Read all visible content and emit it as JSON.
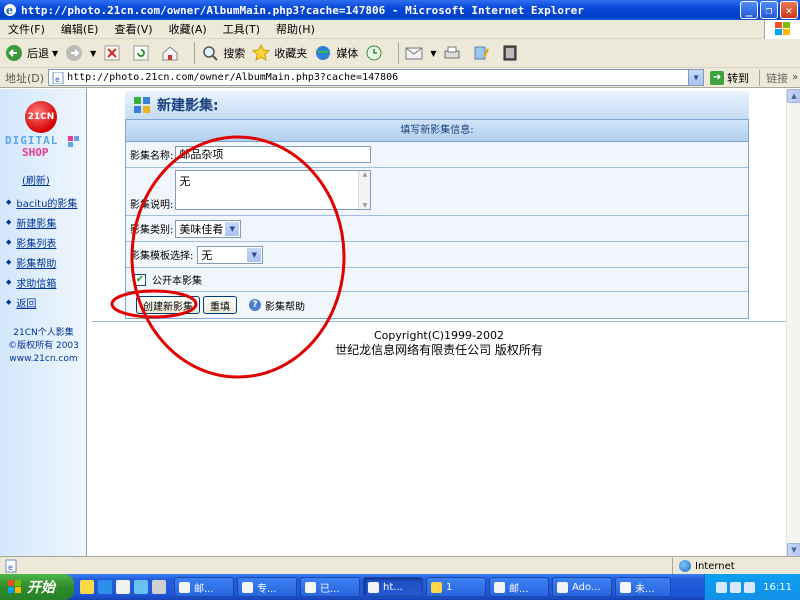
{
  "window": {
    "title": "http://photo.21cn.com/owner/AlbumMain.php3?cache=147806 - Microsoft Internet Explorer"
  },
  "menu": [
    "文件(F)",
    "编辑(E)",
    "查看(V)",
    "收藏(A)",
    "工具(T)",
    "帮助(H)"
  ],
  "toolbar": {
    "back": "后退",
    "search": "搜索",
    "favorites": "收藏夹",
    "media": "媒体"
  },
  "address": {
    "label": "地址(D)",
    "url": "http://photo.21cn.com/owner/AlbumMain.php3?cache=147806",
    "go": "转到",
    "links": "链接"
  },
  "sidebar": {
    "logo_circle": "21CN",
    "logo_digital": "DIGITAL",
    "logo_shop": "SHOP",
    "refresh": "(刷新)",
    "items": [
      {
        "label": "bacitu的影集"
      },
      {
        "label": "新建影集"
      },
      {
        "label": "影集列表"
      },
      {
        "label": "影集帮助"
      },
      {
        "label": "求助信箱"
      },
      {
        "label": "返回"
      }
    ],
    "footer": [
      "21CN个人影集",
      "©版权所有 2003",
      "www.21cn.com"
    ]
  },
  "form": {
    "heading": "新建影集:",
    "info": "填写新影集信息:",
    "name_label": "影集名称:",
    "name_value": "邮品杂项",
    "desc_label": "影集说明:",
    "desc_value": "无",
    "category_label": "影集类别:",
    "category_value": "美味佳肴",
    "template_label": "影集模板选择:",
    "template_value": "无",
    "public_label": "公开本影集",
    "public_checked": true,
    "create_button": "创建新影集",
    "reset_button": "重填",
    "help_link": "影集帮助"
  },
  "footer": {
    "copyright": "Copyright(C)1999-2002",
    "company": "世纪龙信息网络有限责任公司 版权所有"
  },
  "status": {
    "zone": "Internet"
  },
  "taskbar": {
    "start": "开始",
    "tasks": [
      "邮...",
      "专...",
      "已...",
      "ht...",
      "1",
      "邮...",
      "Ado...",
      "未..."
    ],
    "clock": "16:11"
  },
  "colors": {
    "annotation": "#e00000",
    "link": "#003399",
    "heading": "#1a3f7e"
  }
}
